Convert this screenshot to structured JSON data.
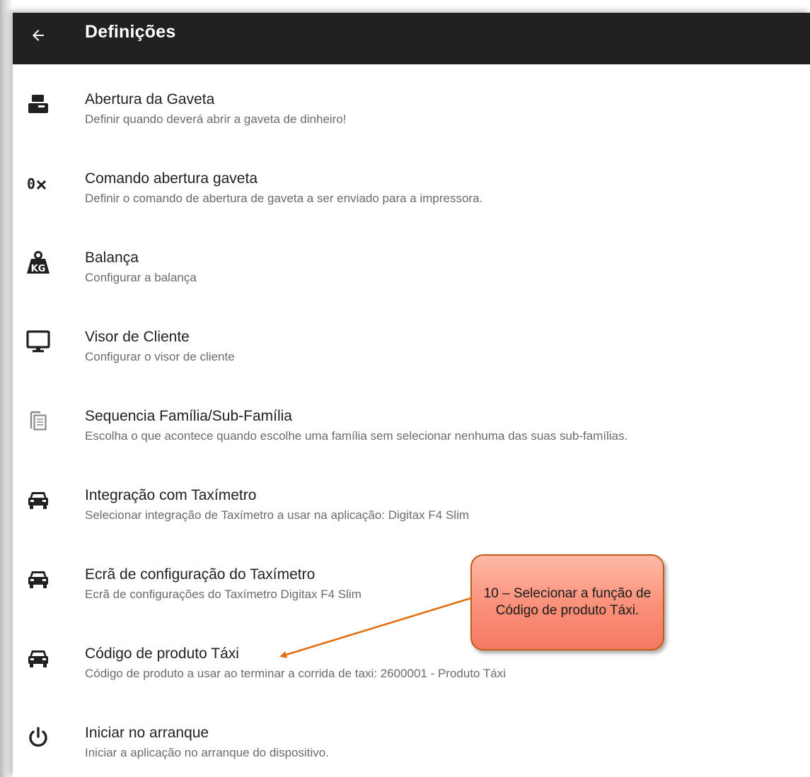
{
  "header": {
    "title": "Definições",
    "back_icon": "arrow-back-icon",
    "background": "#212121"
  },
  "settings": {
    "items": [
      {
        "icon": "cash-drawer-icon",
        "title": "Abertura da Gaveta",
        "summary": "Definir quando deverá abrir a gaveta de dinheiro!"
      },
      {
        "icon": "hex-command-icon",
        "title": "Comando abertura gaveta",
        "summary": "Definir o comando de abertura de gaveta a ser enviado para a impressora."
      },
      {
        "icon": "weight-kg-icon",
        "title": "Balança",
        "summary": "Configurar a balança"
      },
      {
        "icon": "monitor-icon",
        "title": "Visor de Cliente",
        "summary": "Configurar o visor de cliente"
      },
      {
        "icon": "copy-document-icon",
        "title": "Sequencia Família/Sub-Família",
        "summary": "Escolha o que acontece quando escolhe uma família sem selecionar nenhuma das suas sub-famílias."
      },
      {
        "icon": "taxi-icon",
        "title": "Integração com Taxímetro",
        "summary": "Selecionar integração de Taxímetro a usar na aplicação: Digitax F4 Slim"
      },
      {
        "icon": "taxi-icon",
        "title": "Ecrã de configuração do Taxímetro",
        "summary": "Ecrã de configurações do Taxímetro Digitax F4 Slim"
      },
      {
        "icon": "taxi-icon",
        "title": "Código de produto Táxi",
        "summary": "Código de produto a usar ao terminar a corrida de taxi: 2600001 - Produto Táxi"
      },
      {
        "icon": "power-icon",
        "title": "Iniciar no arranque",
        "summary": "Iniciar a aplicação no arranque do dispositivo."
      }
    ]
  },
  "annotation": {
    "text": "10 – Selecionar a função de Código de produto Táxi.",
    "fill": "#fa8f78",
    "border": "#c55a11"
  }
}
